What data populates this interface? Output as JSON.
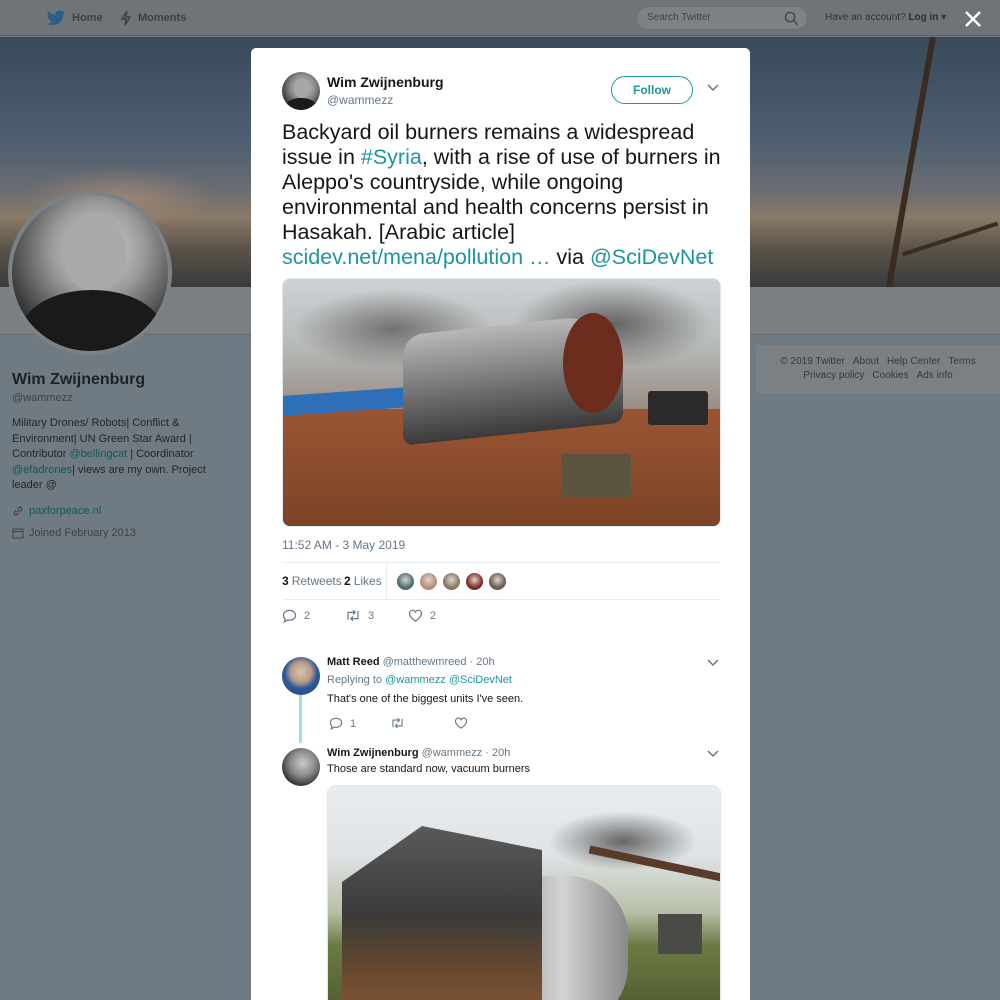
{
  "topnav": {
    "home": "Home",
    "moments": "Moments",
    "search_placeholder": "Search Twitter",
    "have_account": "Have an account?",
    "login": "Log in"
  },
  "profile": {
    "name": "Wim Zwijnenburg",
    "handle": "@wammezz",
    "bio_parts": [
      "Military Drones/ Robots| Conflict & Environment| UN Green Star Award | Contributor ",
      "@bellingcat",
      " | Coordinator ",
      "@efadrones",
      "| views are my own. Project leader @"
    ],
    "url": "paxforpeace.nl",
    "joined": "Joined February 2013"
  },
  "footer": {
    "row1": [
      "© 2019 Twitter",
      "About",
      "Help Center",
      "Terms"
    ],
    "row2": [
      "Privacy policy",
      "Cookies",
      "Ads info"
    ]
  },
  "tweet": {
    "author_name": "Wim Zwijnenburg",
    "author_handle": "@wammezz",
    "follow_label": "Follow",
    "text_parts": [
      "Backyard oil burners remains a widespread issue in ",
      "#Syria",
      ", with a rise of use of burners in Aleppo's countryside, while ongoing environmental and health concerns persist in Hasakah. [Arabic article] ",
      "scidev.net/mena/pollution …",
      " via ",
      "@SciDevNet"
    ],
    "timestamp": "11:52 AM - 3 May 2019",
    "retweets_count": "3",
    "retweets_label": "Retweets",
    "likes_count": "2",
    "likes_label": "Likes",
    "liker_colors": [
      "#4a6b74",
      "#b88c7a",
      "#8a7660",
      "#7a2a22",
      "#6a5a52"
    ],
    "actions": {
      "reply_count": "2",
      "retweet_count": "3",
      "like_count": "2"
    }
  },
  "replies": [
    {
      "name": "Matt Reed",
      "handle": "@matthewmreed",
      "time": "· 20h",
      "replying_prefix": "Replying to",
      "replying_to": "@wammezz @SciDevNet",
      "text": "That's one of the biggest units I've seen.",
      "reply_count": "1"
    },
    {
      "name": "Wim Zwijnenburg",
      "handle": "@wammezz",
      "time": "· 20h",
      "text": "Those are standard now, vacuum burners"
    }
  ],
  "colors": {
    "accent": "#1b95a0",
    "muted": "#657786",
    "overlay": "#6f7a82"
  }
}
